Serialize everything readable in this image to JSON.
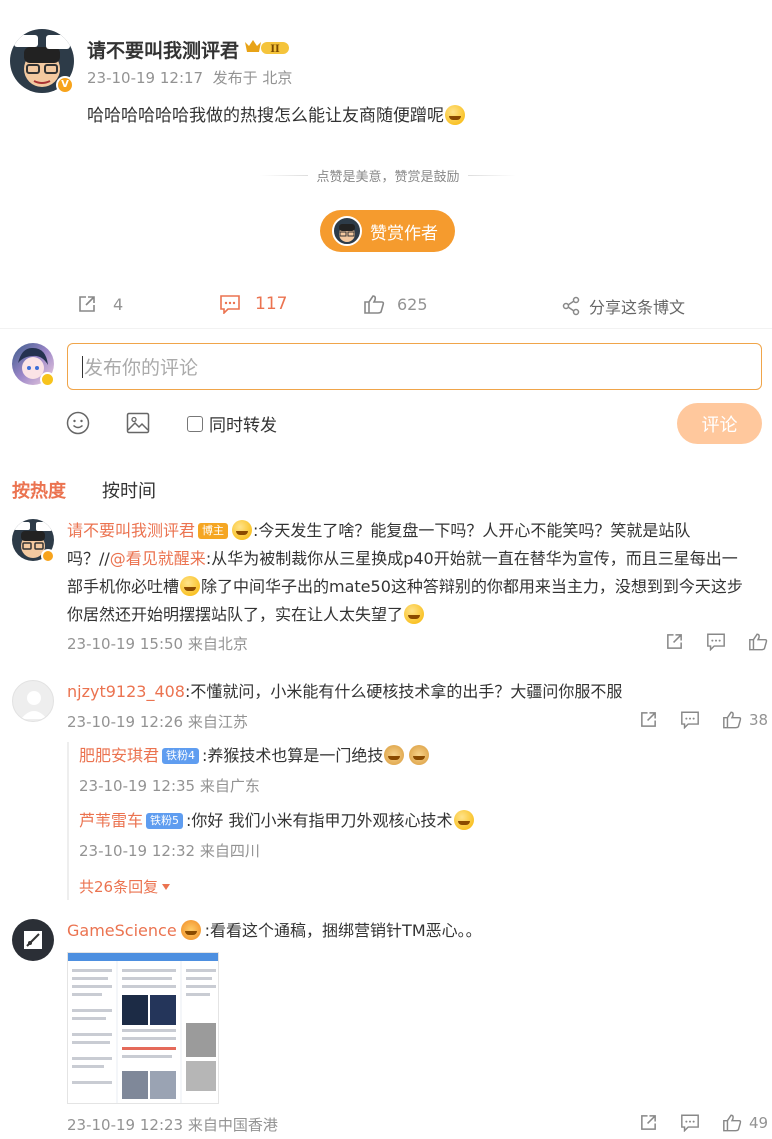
{
  "post": {
    "author": "请不要叫我测评君",
    "timestamp": "23-10-19 12:17",
    "source": "发布于 北京",
    "content": "哈哈哈哈哈哈我做的热搜怎么能让友商随便蹭呢",
    "level_badge": "II"
  },
  "reward": {
    "tagline": "点赞是美意，赞赏是鼓励",
    "button_label": "赞赏作者"
  },
  "actions": {
    "forward_count": "4",
    "comment_count": "117",
    "like_count": "625",
    "share_label": "分享这条博文"
  },
  "composer": {
    "placeholder": "发布你的评论",
    "repost_label": "同时转发",
    "submit_label": "评论"
  },
  "sort_tabs": {
    "hot": "按热度",
    "time": "按时间"
  },
  "comments": [
    {
      "user": "请不要叫我测评君",
      "badge": "博主",
      "text_line1": ":今天发生了啥？能复盘一下吗？人开心不能笑吗？笑就是站队",
      "text_line2_prefix": "吗？//",
      "mention": "@看见就醒来",
      "text_line2_rest": ":从华为被制裁你从三星换成p40开始就一直在替华为宣传，而且三星每出一",
      "text_line3a": "部手机你必吐槽",
      "text_line3b": "除了中间华子出的mate50这种答辩别的你都用来当主力，没想到到今天这步",
      "text_line4": "你居然还开始明摆摆站队了，实在让人太失望了",
      "time": "23-10-19 15:50 来自北京"
    },
    {
      "user": "njzyt9123_408",
      "text": ":不懂就问，小米能有什么硬核技术拿的出手？大疆问你服不服",
      "time": "23-10-19 12:26 来自江苏",
      "likes": "38",
      "replies": [
        {
          "user": "肥肥安琪君",
          "badge": "铁粉4",
          "text": ":养猴技术也算是一门绝技",
          "time": "23-10-19 12:35 来自广东"
        },
        {
          "user": "芦苇雷车",
          "badge": "铁粉5",
          "text": ":你好 我们小米有指甲刀外观核心技术",
          "time": "23-10-19 12:32 来自四川"
        }
      ],
      "more_replies": "共26条回复"
    },
    {
      "user": "GameScience",
      "text": ":看看这个通稿，捆绑营销针TM恶心。。",
      "time": "23-10-19 12:23 来自中国香港",
      "likes": "49"
    }
  ],
  "colors": {
    "accent": "#eb7350",
    "reward_button": "#f59b2e",
    "submit_button": "#ffc89d",
    "input_border": "#f0a54a",
    "tag_blogger": "#f5a623",
    "tag_fan": "#5f9df0"
  }
}
